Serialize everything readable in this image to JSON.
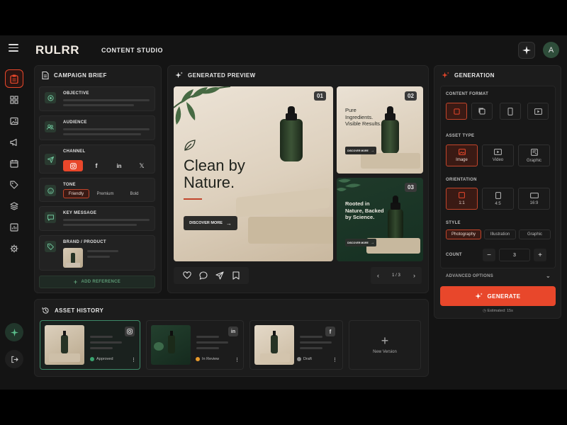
{
  "header": {
    "logo": "RULRR",
    "subtitle": "CONTENT STUDIO",
    "avatar_initial": "A"
  },
  "brief": {
    "title": "CAMPAIGN BRIEF",
    "objective": "OBJECTIVE",
    "audience": "AUDIENCE",
    "channel": "CHANNEL",
    "channels": [
      "instagram-icon",
      "facebook-icon",
      "linkedin-icon",
      "x-icon"
    ],
    "tone": "TONE",
    "tones": [
      "Friendly",
      "Premium",
      "Bold"
    ],
    "key_message": "KEY MESSAGE",
    "brand": "BRAND / PRODUCT",
    "add_reference": "ADD REFERENCE"
  },
  "preview": {
    "title": "GENERATED PREVIEW",
    "card1": {
      "num": "01",
      "headline": "Clean by Nature.",
      "cta": "DISCOVER MORE"
    },
    "card2": {
      "num": "02",
      "headline": "Pure Ingredients. Visible Results.",
      "cta": "DISCOVER MORE"
    },
    "card3": {
      "num": "03",
      "headline": "Rooted in Nature, Backed by Science.",
      "cta": "DISCOVER MORE"
    },
    "pager": "1 / 3"
  },
  "generation": {
    "title": "GENERATION",
    "content_format": "CONTENT FORMAT",
    "asset_type": "ASSET TYPE",
    "asset_types": [
      "Image",
      "Video",
      "Graphic"
    ],
    "orientation": "ORIENTATION",
    "orientations": [
      "1:1",
      "4:5",
      "16:9"
    ],
    "style": "STYLE",
    "styles": [
      "Photography",
      "Illustration",
      "Graphic"
    ],
    "count_label": "COUNT",
    "count_value": "3",
    "advanced": "ADVANCED OPTIONS",
    "generate": "GENERATE",
    "estimated": "Estimated: 15s"
  },
  "history": {
    "title": "ASSET HISTORY",
    "items": [
      {
        "status": "Approved",
        "status_color": "#3aa36f",
        "channel": "instagram-icon"
      },
      {
        "status": "In Review",
        "status_color": "#e89a2b",
        "channel": "linkedin-icon"
      },
      {
        "status": "Draft",
        "status_color": "#8a8a8a",
        "channel": "facebook-icon"
      }
    ],
    "new_version": "New Version"
  },
  "colors": {
    "accent": "#e8472b",
    "green": "#2e5a44",
    "bg": "#141414"
  }
}
